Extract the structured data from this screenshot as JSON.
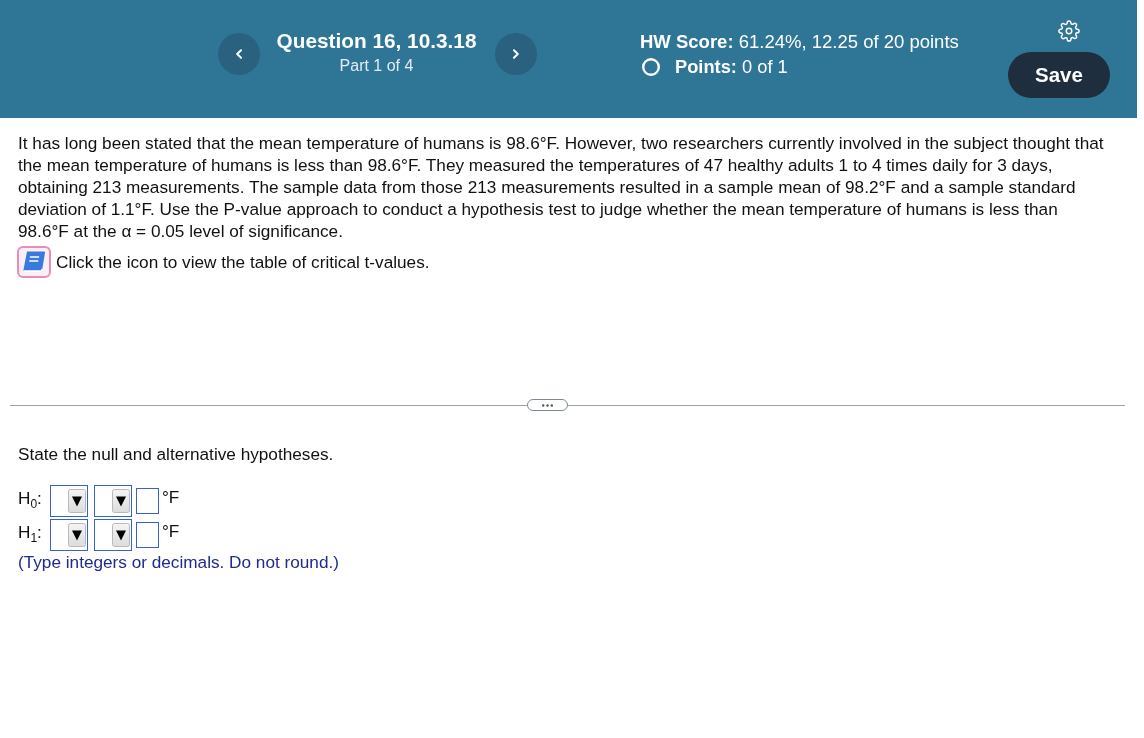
{
  "header": {
    "question": {
      "title": "Question 16, 10.3.18",
      "part": "Part 1 of 4"
    },
    "score": "**HW Score:** 61.24%, 12.25 of 20 points",
    "points": "**Points:** 0 of 1",
    "save_button": "Save"
  },
  "problem": {
    "text": "It has long been stated that the mean temperature of humans is 98.6°F. However, two researchers currently involved in the subject thought that the mean temperature of humans is less than 98.6°F. They measured the temperatures of 47 healthy adults 1 to 4 times daily for 3 days, obtaining 213 measurements. The sample data from those 213 measurements resulted in a sample mean of 98.2°F and a sample standard deviation of 1.1°F. Use the P-value approach to conduct a hypothesis test to judge whether the mean temperature of humans is less than 98.6°F at the α = 0.05 level of significance.",
    "table_instruction": "Click the icon to view the table of critical t-values."
  },
  "hypotheses": {
    "prompt": "State the null and alternative hypotheses.",
    "rows": [
      {
        "label": "H$_{0}$:",
        "unit": "°F"
      },
      {
        "label": "H$_{1}$:",
        "unit": "°F"
      }
    ],
    "note": "(Type integers or decimals. Do not round.)"
  }
}
